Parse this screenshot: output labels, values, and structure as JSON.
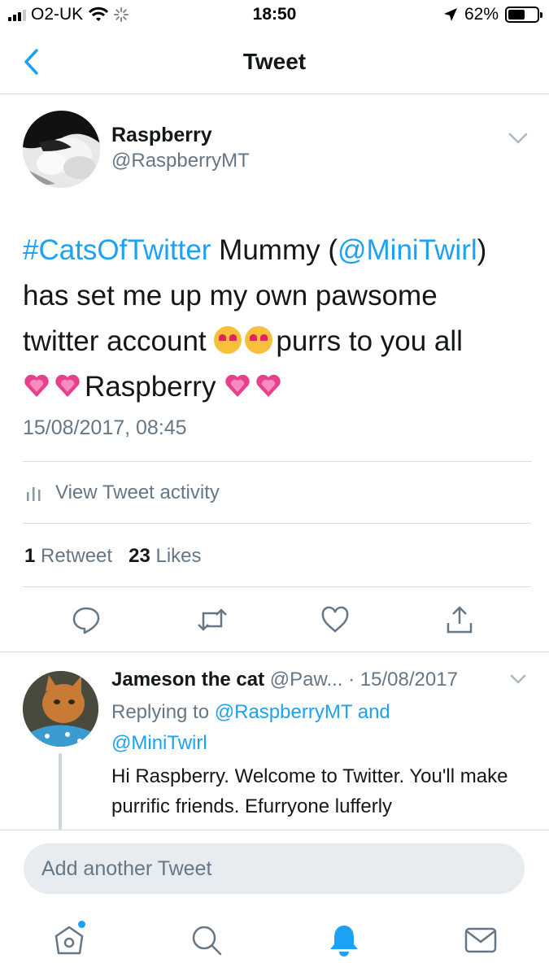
{
  "status_bar": {
    "carrier": "O2-UK",
    "time": "18:50",
    "battery": "62%",
    "battery_level": 0.62
  },
  "nav": {
    "title": "Tweet",
    "back_icon": "chevron-left-icon"
  },
  "tweet": {
    "author_name": "Raspberry",
    "author_handle": "@RaspberryMT",
    "text_parts": {
      "hashtag": "#CatsOfTwitter",
      "t1": " Mummy (",
      "mention": "@MiniTwirl",
      "t2": ")",
      "t3": "has set me up my own pawsome",
      "t4": "twitter account ",
      "t5": "purrs to you all",
      "t6": "Raspberry "
    },
    "timestamp": "15/08/2017, 08:45",
    "activity_label": "View Tweet activity",
    "retweet_count": "1",
    "retweet_label": " Retweet",
    "like_count": "23",
    "like_label": " Likes"
  },
  "actions": {
    "reply_icon": "reply-icon",
    "retweet_icon": "retweet-icon",
    "like_icon": "heart-icon",
    "share_icon": "share-icon"
  },
  "reply": {
    "author_name": "Jameson the cat",
    "meta": " @Paw... · 15/08/2017",
    "replying_prefix": "Replying to ",
    "replying_user1": "@RaspberryMT",
    "replying_and": " and",
    "replying_user2": "@MiniTwirl",
    "text": "Hi Raspberry. Welcome to Twitter. You'll make purrific friends. Efurryone lufferly"
  },
  "composer": {
    "placeholder": "Add another Tweet"
  },
  "tabbar": {
    "items": [
      "home-icon",
      "search-icon",
      "notifications-icon",
      "messages-icon"
    ],
    "active": "notifications-icon"
  },
  "colors": {
    "accent": "#1da1f2",
    "text_primary": "#14171a",
    "text_secondary": "#657786",
    "divider": "#d6dbdf",
    "heart_emoji": "#e8408c",
    "cat_emoji": "#f8c03a"
  }
}
